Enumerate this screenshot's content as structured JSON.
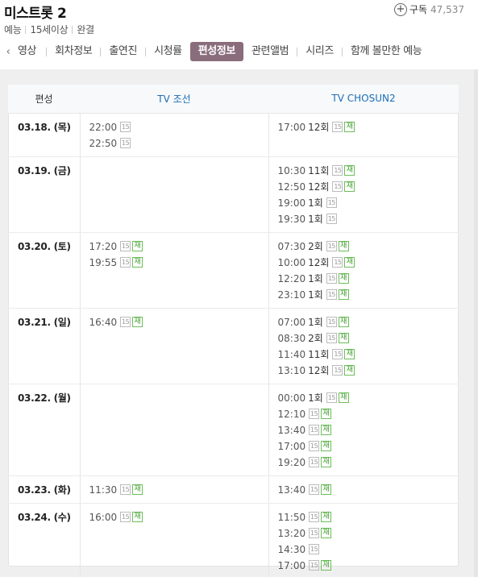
{
  "header": {
    "title": "미스트롯 2",
    "genre": "예능",
    "rating": "15세이상",
    "status": "완결",
    "subscribe_label": "구독",
    "subscribe_count": "47,537"
  },
  "tabs": [
    {
      "label": "영상"
    },
    {
      "label": "회차정보"
    },
    {
      "label": "출연진"
    },
    {
      "label": "시청률"
    },
    {
      "label": "편성정보",
      "active": true
    },
    {
      "label": "관련앨범"
    },
    {
      "label": "시리즈"
    },
    {
      "label": "함께 볼만한 예능"
    }
  ],
  "table": {
    "headers": {
      "date": "편성",
      "channel_a": "TV 조선",
      "channel_b": "TV CHOSUN2"
    },
    "badge_rating": "15",
    "badge_rerun": "재",
    "rows": [
      {
        "date": "03.18. (목)",
        "a": [
          {
            "time": "22:00",
            "ep": "",
            "rerun": false
          },
          {
            "time": "22:50",
            "ep": "",
            "rerun": false
          }
        ],
        "b": [
          {
            "time": "17:00",
            "ep": "12회",
            "rerun": true
          }
        ]
      },
      {
        "date": "03.19. (금)",
        "a": [],
        "b": [
          {
            "time": "10:30",
            "ep": "11회",
            "rerun": true
          },
          {
            "time": "12:50",
            "ep": "12회",
            "rerun": true
          },
          {
            "time": "19:00",
            "ep": "1회",
            "rerun": false
          },
          {
            "time": "19:30",
            "ep": "1회",
            "rerun": false
          }
        ]
      },
      {
        "date": "03.20. (토)",
        "a": [
          {
            "time": "17:20",
            "ep": "",
            "rerun": true
          },
          {
            "time": "19:55",
            "ep": "",
            "rerun": true
          }
        ],
        "b": [
          {
            "time": "07:30",
            "ep": "2회",
            "rerun": true
          },
          {
            "time": "10:00",
            "ep": "12회",
            "rerun": true
          },
          {
            "time": "12:20",
            "ep": "1회",
            "rerun": true
          },
          {
            "time": "23:10",
            "ep": "1회",
            "rerun": true
          }
        ]
      },
      {
        "date": "03.21. (일)",
        "a": [
          {
            "time": "16:40",
            "ep": "",
            "rerun": true
          }
        ],
        "b": [
          {
            "time": "07:00",
            "ep": "1회",
            "rerun": true
          },
          {
            "time": "08:30",
            "ep": "2회",
            "rerun": true
          },
          {
            "time": "11:40",
            "ep": "11회",
            "rerun": true
          },
          {
            "time": "13:10",
            "ep": "12회",
            "rerun": true
          }
        ]
      },
      {
        "date": "03.22. (월)",
        "a": [],
        "b": [
          {
            "time": "00:00",
            "ep": "1회",
            "rerun": true
          },
          {
            "time": "12:10",
            "ep": "",
            "rerun": true
          },
          {
            "time": "13:40",
            "ep": "",
            "rerun": true
          },
          {
            "time": "17:00",
            "ep": "",
            "rerun": true
          },
          {
            "time": "19:20",
            "ep": "",
            "rerun": true
          }
        ]
      },
      {
        "date": "03.23. (화)",
        "a": [
          {
            "time": "11:30",
            "ep": "",
            "rerun": true
          }
        ],
        "b": [
          {
            "time": "13:40",
            "ep": "",
            "rerun": true
          }
        ]
      },
      {
        "date": "03.24. (수)",
        "a": [
          {
            "time": "16:00",
            "ep": "",
            "rerun": true
          }
        ],
        "b": [
          {
            "time": "11:50",
            "ep": "",
            "rerun": true
          },
          {
            "time": "13:20",
            "ep": "",
            "rerun": true
          },
          {
            "time": "14:30",
            "ep": "",
            "rerun": false
          },
          {
            "time": "17:00",
            "ep": "",
            "rerun": true
          }
        ]
      }
    ]
  }
}
